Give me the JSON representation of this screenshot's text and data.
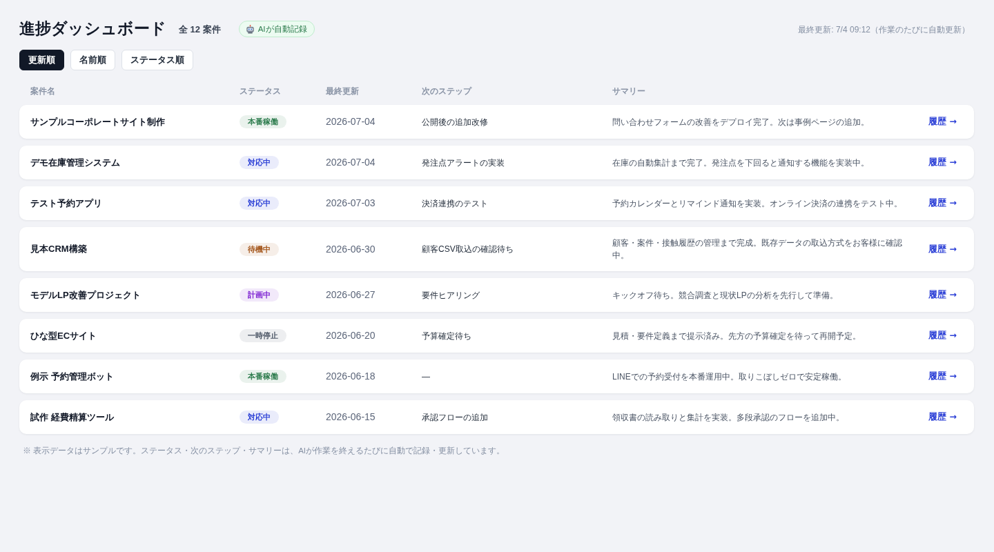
{
  "header": {
    "title": "進捗ダッシュボード",
    "count": "全 12 案件",
    "ai_badge": "AIが自動記録",
    "last_updated": "最終更新: 7/4 09:12（作業のたびに自動更新）"
  },
  "sort_buttons": [
    {
      "label": "更新順",
      "selected": true
    },
    {
      "label": "名前順",
      "selected": false
    },
    {
      "label": "ステータス順",
      "selected": false
    }
  ],
  "columns": [
    "案件名",
    "ステータス",
    "最終更新",
    "次のステップ",
    "サマリー"
  ],
  "projects": [
    {
      "name": "サンプルコーポレートサイト制作",
      "status": {
        "label": "本番稼働",
        "color": "#2f7d4f"
      },
      "updated": "2026-07-04",
      "next_step": "公開後の追加改修",
      "summary": "問い合わせフォームの改善をデプロイ完了。次は事例ページの追加。",
      "link": "履歴 →"
    },
    {
      "name": "デモ在庫管理システム",
      "status": {
        "label": "対応中",
        "color": "#2b3fd6"
      },
      "updated": "2026-07-04",
      "next_step": "発注点アラートの実装",
      "summary": "在庫の自動集計まで完了。発注点を下回ると通知する機能を実装中。",
      "link": "履歴 →"
    },
    {
      "name": "テスト予約アプリ",
      "status": {
        "label": "対応中",
        "color": "#2b3fd6"
      },
      "updated": "2026-07-03",
      "next_step": "決済連携のテスト",
      "summary": "予約カレンダーとリマインド通知を実装。オンライン決済の連携をテスト中。",
      "link": "履歴 →"
    },
    {
      "name": "見本CRM構築",
      "status": {
        "label": "待機中",
        "color": "#a4561b"
      },
      "updated": "2026-06-30",
      "next_step": "顧客CSV取込の確認待ち",
      "summary": "顧客・案件・接触履歴の管理まで完成。既存データの取込方式をお客様に確認中。",
      "link": "履歴 →"
    },
    {
      "name": "モデルLP改善プロジェクト",
      "status": {
        "label": "計画中",
        "color": "#7b1fd1"
      },
      "updated": "2026-06-27",
      "next_step": "要件ヒアリング",
      "summary": "キックオフ待ち。競合調査と現状LPの分析を先行して準備。",
      "link": "履歴 →"
    },
    {
      "name": "ひな型ECサイト",
      "status": {
        "label": "一時停止",
        "color": "#4b5565"
      },
      "updated": "2026-06-20",
      "next_step": "予算確定待ち",
      "summary": "見積・要件定義まで提示済み。先方の予算確定を待って再開予定。",
      "link": "履歴 →"
    },
    {
      "name": "例示 予約管理ボット",
      "status": {
        "label": "本番稼働",
        "color": "#2f7d4f"
      },
      "updated": "2026-06-18",
      "next_step": "—",
      "summary": "LINEでの予約受付を本番運用中。取りこぼしゼロで安定稼働。",
      "link": "履歴 →"
    },
    {
      "name": "試作 経費精算ツール",
      "status": {
        "label": "対応中",
        "color": "#2b3fd6"
      },
      "updated": "2026-06-15",
      "next_step": "承認フローの追加",
      "summary": "領収書の読み取りと集計を実装。多段承認のフローを追加中。",
      "link": "履歴 →"
    }
  ],
  "footnote": "※ 表示データはサンプルです。ステータス・次のステップ・サマリーは、AIが作業を終えるたびに自動で記録・更新しています。"
}
